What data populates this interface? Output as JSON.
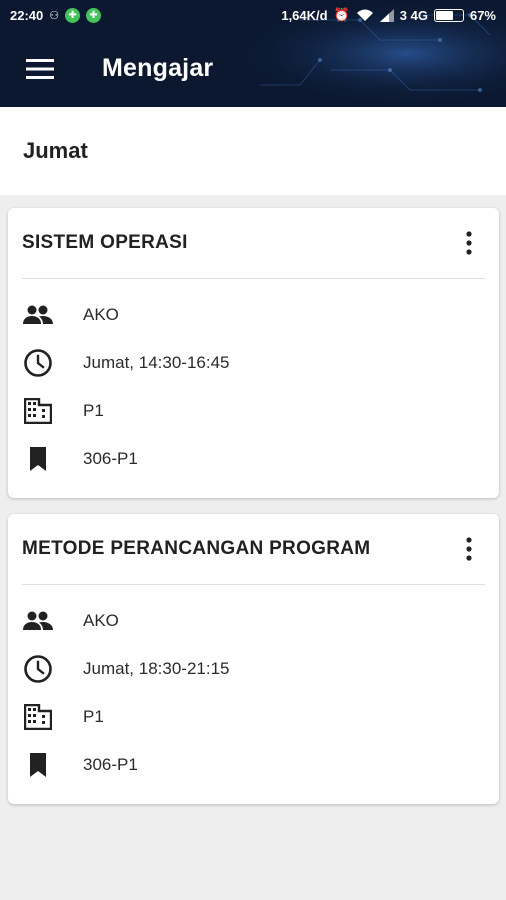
{
  "status_bar": {
    "time": "22:40",
    "speed": "1,64K/d",
    "network": "3 4G",
    "battery": "67%",
    "battery_level": 0.67
  },
  "app_bar": {
    "menu_icon": "menu-icon",
    "title": "Mengajar"
  },
  "day": "Jumat",
  "colors": {
    "app_bar_bg": "#0b1830",
    "card_bg": "#ffffff",
    "page_bg": "#eeeeee"
  },
  "classes": [
    {
      "title": "SISTEM OPERASI",
      "lecturer": "AKO",
      "schedule": "Jumat, 14:30-16:45",
      "building": "P1",
      "room": "306-P1"
    },
    {
      "title": "METODE PERANCANGAN PROGRAM",
      "lecturer": "AKO",
      "schedule": "Jumat, 18:30-21:15",
      "building": "P1",
      "room": "306-P1"
    }
  ]
}
